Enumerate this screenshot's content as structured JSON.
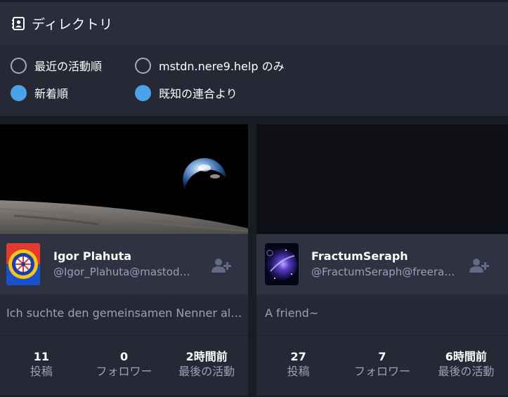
{
  "header": {
    "title": "ディレクトリ",
    "icon": "address-book-icon"
  },
  "filters": {
    "recent": {
      "label": "最近の活動順",
      "selected": false
    },
    "local": {
      "label": "mstdn.nere9.help のみ",
      "selected": false
    },
    "newest": {
      "label": "新着順",
      "selected": true
    },
    "federated": {
      "label": "既知の連合より",
      "selected": true
    }
  },
  "colors": {
    "accent": "#4ba2e7",
    "card_bg": "#2f3241",
    "muted": "#9ca0b8"
  },
  "cards": [
    {
      "display_name": "Igor Plahuta",
      "acct": "@Igor_Plahuta@mastod…",
      "bio": "Ich suchte den gemeinsamen Nenner all…",
      "stats": [
        {
          "value": "11",
          "label": "投稿"
        },
        {
          "value": "0",
          "label": "フォロワー"
        },
        {
          "value": "2時間前",
          "label": "最後の活動"
        }
      ]
    },
    {
      "display_name": "FractumSeraph",
      "acct": "@FractumSeraph@freera…",
      "bio": "A friend~",
      "stats": [
        {
          "value": "27",
          "label": "投稿"
        },
        {
          "value": "7",
          "label": "フォロワー"
        },
        {
          "value": "6時間前",
          "label": "最後の活動"
        }
      ]
    }
  ]
}
